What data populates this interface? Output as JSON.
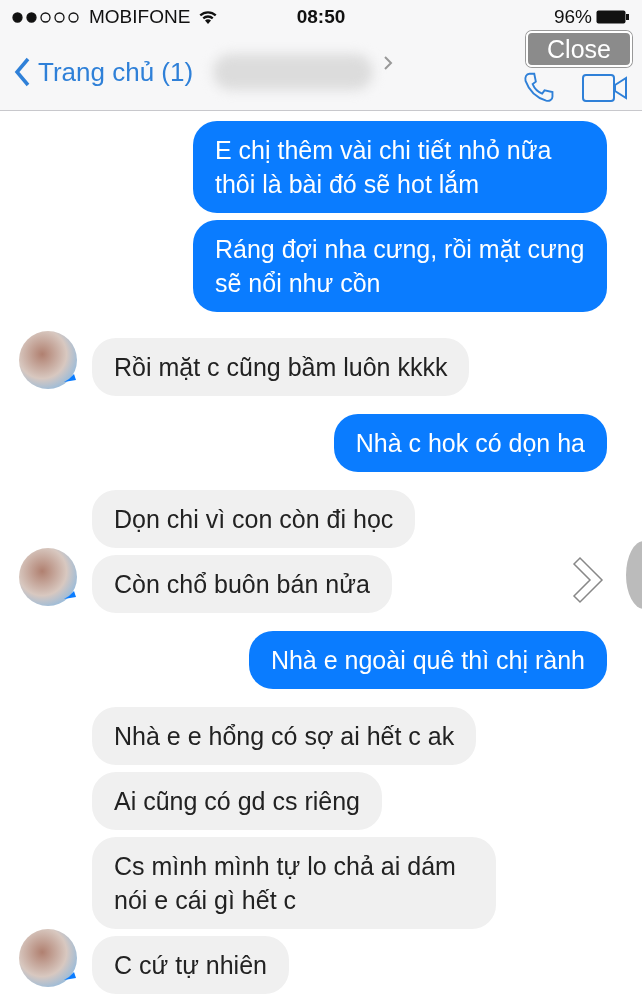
{
  "status_bar": {
    "carrier": "MOBIFONE",
    "time": "08:50",
    "battery": "96%"
  },
  "nav": {
    "back_label": "Trang chủ (1)"
  },
  "overlay": {
    "close_label": "Close"
  },
  "groups": [
    {
      "kind": "sent",
      "messages": [
        "E chị thêm vài chi tiết nhỏ nữa thôi là bài đó sẽ hot lắm",
        "Ráng đợi nha cưng, rồi mặt cưng sẽ nổi như cồn"
      ]
    },
    {
      "kind": "received",
      "messages": [
        "Rồi mặt c cũng bầm luôn kkkk"
      ]
    },
    {
      "kind": "sent",
      "messages": [
        "Nhà c hok có dọn ha"
      ]
    },
    {
      "kind": "received",
      "messages": [
        "Dọn chi vì con còn đi học",
        "Còn chổ buôn bán nửa"
      ]
    },
    {
      "kind": "sent",
      "messages": [
        "Nhà e ngoài quê thì chị rành"
      ]
    },
    {
      "kind": "received",
      "messages": [
        "Nhà e e hổng có sợ ai hết c ak",
        "Ai cũng có gd cs riêng",
        "Cs mình mình tự lo chả ai dám nói e cái gì hết c",
        "C cứ tự nhiên"
      ]
    }
  ]
}
